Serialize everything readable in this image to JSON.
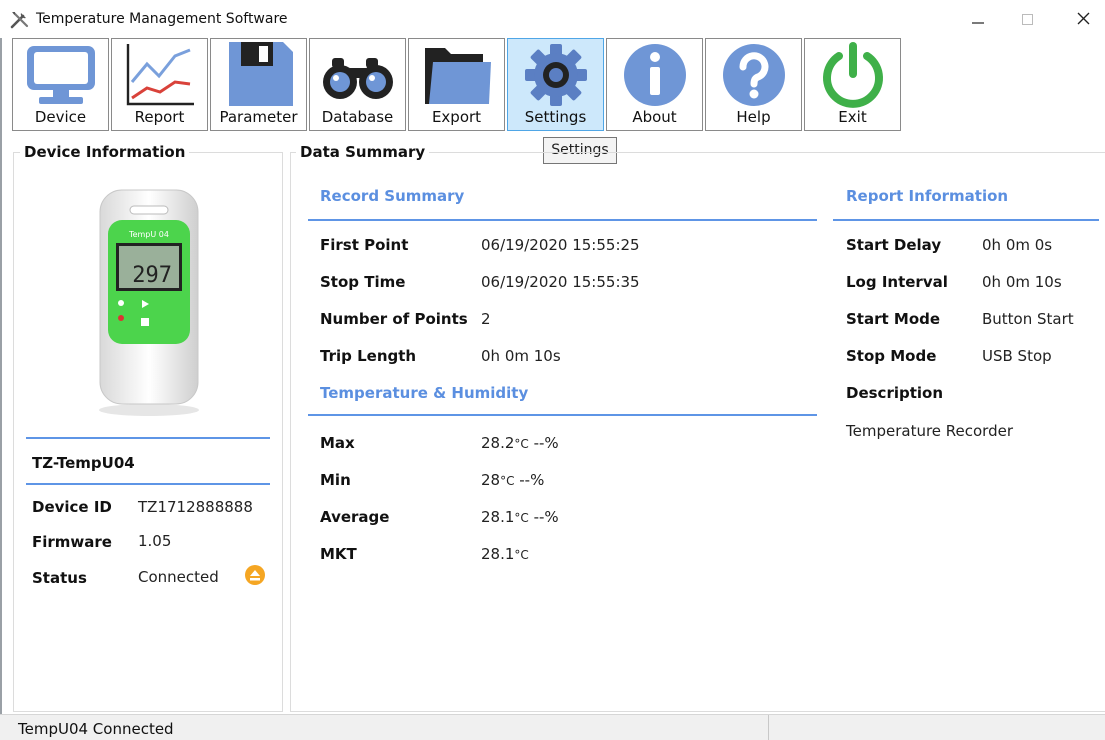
{
  "window": {
    "title": "Temperature Management Software",
    "icon": "tools-icon"
  },
  "toolbar": {
    "buttons": [
      {
        "label": "Device",
        "icon": "monitor-icon"
      },
      {
        "label": "Report",
        "icon": "chart-icon"
      },
      {
        "label": "Parameter",
        "icon": "floppy-disk-icon"
      },
      {
        "label": "Database",
        "icon": "binoculars-icon"
      },
      {
        "label": "Export",
        "icon": "folder-icon"
      },
      {
        "label": "Settings",
        "icon": "gear-icon",
        "active": true
      },
      {
        "label": "About",
        "icon": "info-icon"
      },
      {
        "label": "Help",
        "icon": "question-icon"
      },
      {
        "label": "Exit",
        "icon": "power-icon"
      }
    ],
    "tooltip": "Settings"
  },
  "device_info": {
    "title": "Device Information",
    "name": "TZ-TempU04",
    "device_image": {
      "model_label": "TempU 04",
      "display_reading": "297"
    },
    "rows": [
      {
        "label": "Device ID",
        "value": "TZ1712888888"
      },
      {
        "label": "Firmware",
        "value": "1.05"
      },
      {
        "label": "Status",
        "value": "Connected"
      }
    ],
    "status_icon": "eject-icon"
  },
  "data_summary": {
    "title": "Data Summary",
    "record_summary": {
      "heading": "Record Summary",
      "rows": [
        {
          "label": "First Point",
          "value": "06/19/2020 15:55:25"
        },
        {
          "label": "Stop Time",
          "value": "06/19/2020 15:55:35"
        },
        {
          "label": "Number of Points",
          "value": "2"
        },
        {
          "label": "Trip Length",
          "value": "0h 0m 10s"
        }
      ]
    },
    "temp_humidity": {
      "heading": "Temperature & Humidity",
      "rows": [
        {
          "label": "Max",
          "temp": "28.2",
          "unit": "°C",
          "humidity": " --%"
        },
        {
          "label": "Min",
          "temp": "28",
          "unit": "°C",
          "humidity": " --%"
        },
        {
          "label": "Average",
          "temp": "28.1",
          "unit": "°C",
          "humidity": " --%"
        },
        {
          "label": "MKT",
          "temp": "28.1",
          "unit": "°C",
          "humidity": ""
        }
      ]
    },
    "report_info": {
      "heading": "Report Information",
      "rows": [
        {
          "label": "Start Delay",
          "value": "0h 0m 0s"
        },
        {
          "label": "Log Interval",
          "value": "0h 0m 10s"
        },
        {
          "label": "Start Mode",
          "value": "Button Start"
        },
        {
          "label": "Stop Mode",
          "value": "USB Stop"
        },
        {
          "label": "Description",
          "value": ""
        }
      ],
      "description_text": "Temperature Recorder"
    }
  },
  "statusbar": {
    "text": "TempU04 Connected"
  },
  "colors": {
    "accent": "#5b8fe0",
    "active_button": "#cde8fb",
    "status_icon": "#f5a623",
    "device_green": "#4cd44c"
  }
}
